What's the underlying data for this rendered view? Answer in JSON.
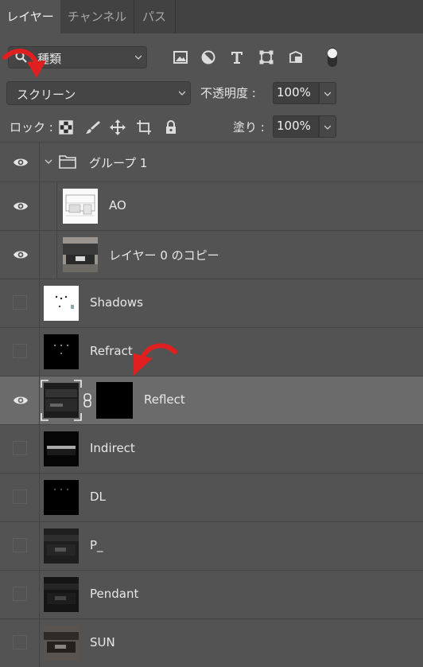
{
  "tabs": [
    {
      "label": "レイヤー"
    },
    {
      "label": "チャンネル"
    },
    {
      "label": "パス"
    }
  ],
  "filter": {
    "kind_label": "種類"
  },
  "blend": {
    "mode": "スクリーン",
    "opacity_label": "不透明度 :",
    "opacity_value": "100%"
  },
  "lock": {
    "label": "ロック :",
    "fill_label": "塗り :",
    "fill_value": "100%"
  },
  "layers": [
    {
      "name": "グループ 1",
      "visible": true,
      "type": "group"
    },
    {
      "name": "AO",
      "visible": true,
      "type": "image"
    },
    {
      "name": "レイヤー 0 のコピー",
      "visible": true,
      "type": "image"
    },
    {
      "name": "Shadows",
      "visible": false,
      "type": "image"
    },
    {
      "name": "Refract",
      "visible": false,
      "type": "image"
    },
    {
      "name": "Reflect",
      "visible": true,
      "type": "image",
      "selected": true,
      "has_mask": true
    },
    {
      "name": "Indirect",
      "visible": false,
      "type": "image"
    },
    {
      "name": "DL",
      "visible": false,
      "type": "image"
    },
    {
      "name": "P_",
      "visible": false,
      "type": "image"
    },
    {
      "name": "Pendant",
      "visible": false,
      "type": "image"
    },
    {
      "name": "SUN",
      "visible": false,
      "type": "image"
    }
  ],
  "colors": {
    "panel_bg": "#535353",
    "tab_bar_bg": "#424242",
    "selected_row": "#6b6b6b",
    "annotation_arrow": "#e02020"
  }
}
